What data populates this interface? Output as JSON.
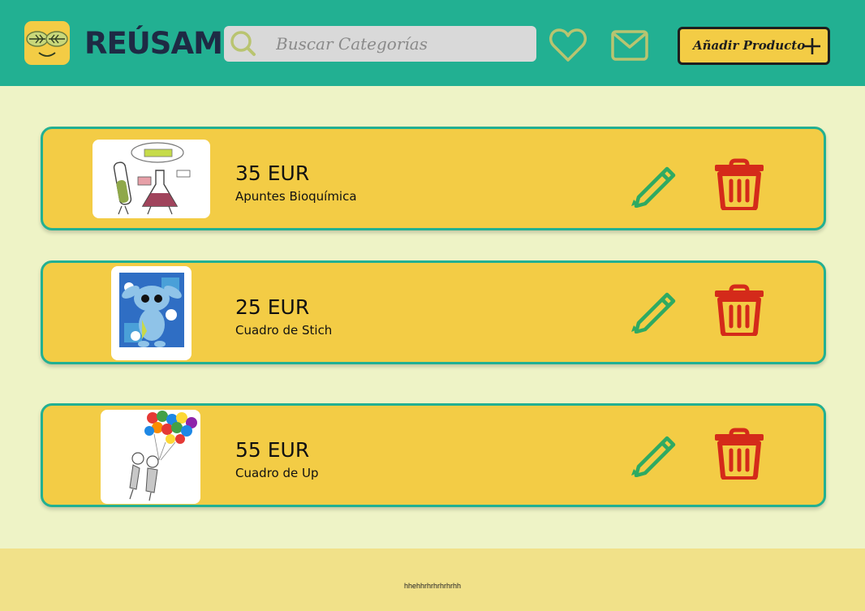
{
  "header": {
    "brand": "REÚSAME",
    "search": {
      "placeholder": "Buscar Categorías",
      "value": ""
    },
    "favorites_icon": "heart-icon",
    "messages_icon": "mail-icon",
    "add_button": {
      "label": "Añadir Producto",
      "icon": "plus-icon"
    }
  },
  "products": [
    {
      "price": "35 EUR",
      "name": "Apuntes Bioquímica",
      "image": "chemistry-drawing"
    },
    {
      "price": "25 EUR",
      "name": "Cuadro de Stich",
      "image": "stitch-painting"
    },
    {
      "price": "55 EUR",
      "name": "Cuadro de Up",
      "image": "up-balloons-drawing"
    }
  ],
  "actions": {
    "edit_icon": "pencil-icon",
    "delete_icon": "trash-icon"
  },
  "footer": {
    "text": "hhehhrhrhrhrhrhh"
  },
  "colors": {
    "header": "#22B092",
    "background": "#EEF3C6",
    "card": "#F3CC45",
    "card_border": "#22B092",
    "edit": "#2EAA62",
    "delete": "#D42A1A",
    "footer": "#F1E189",
    "brand_text": "#1E2A44"
  }
}
